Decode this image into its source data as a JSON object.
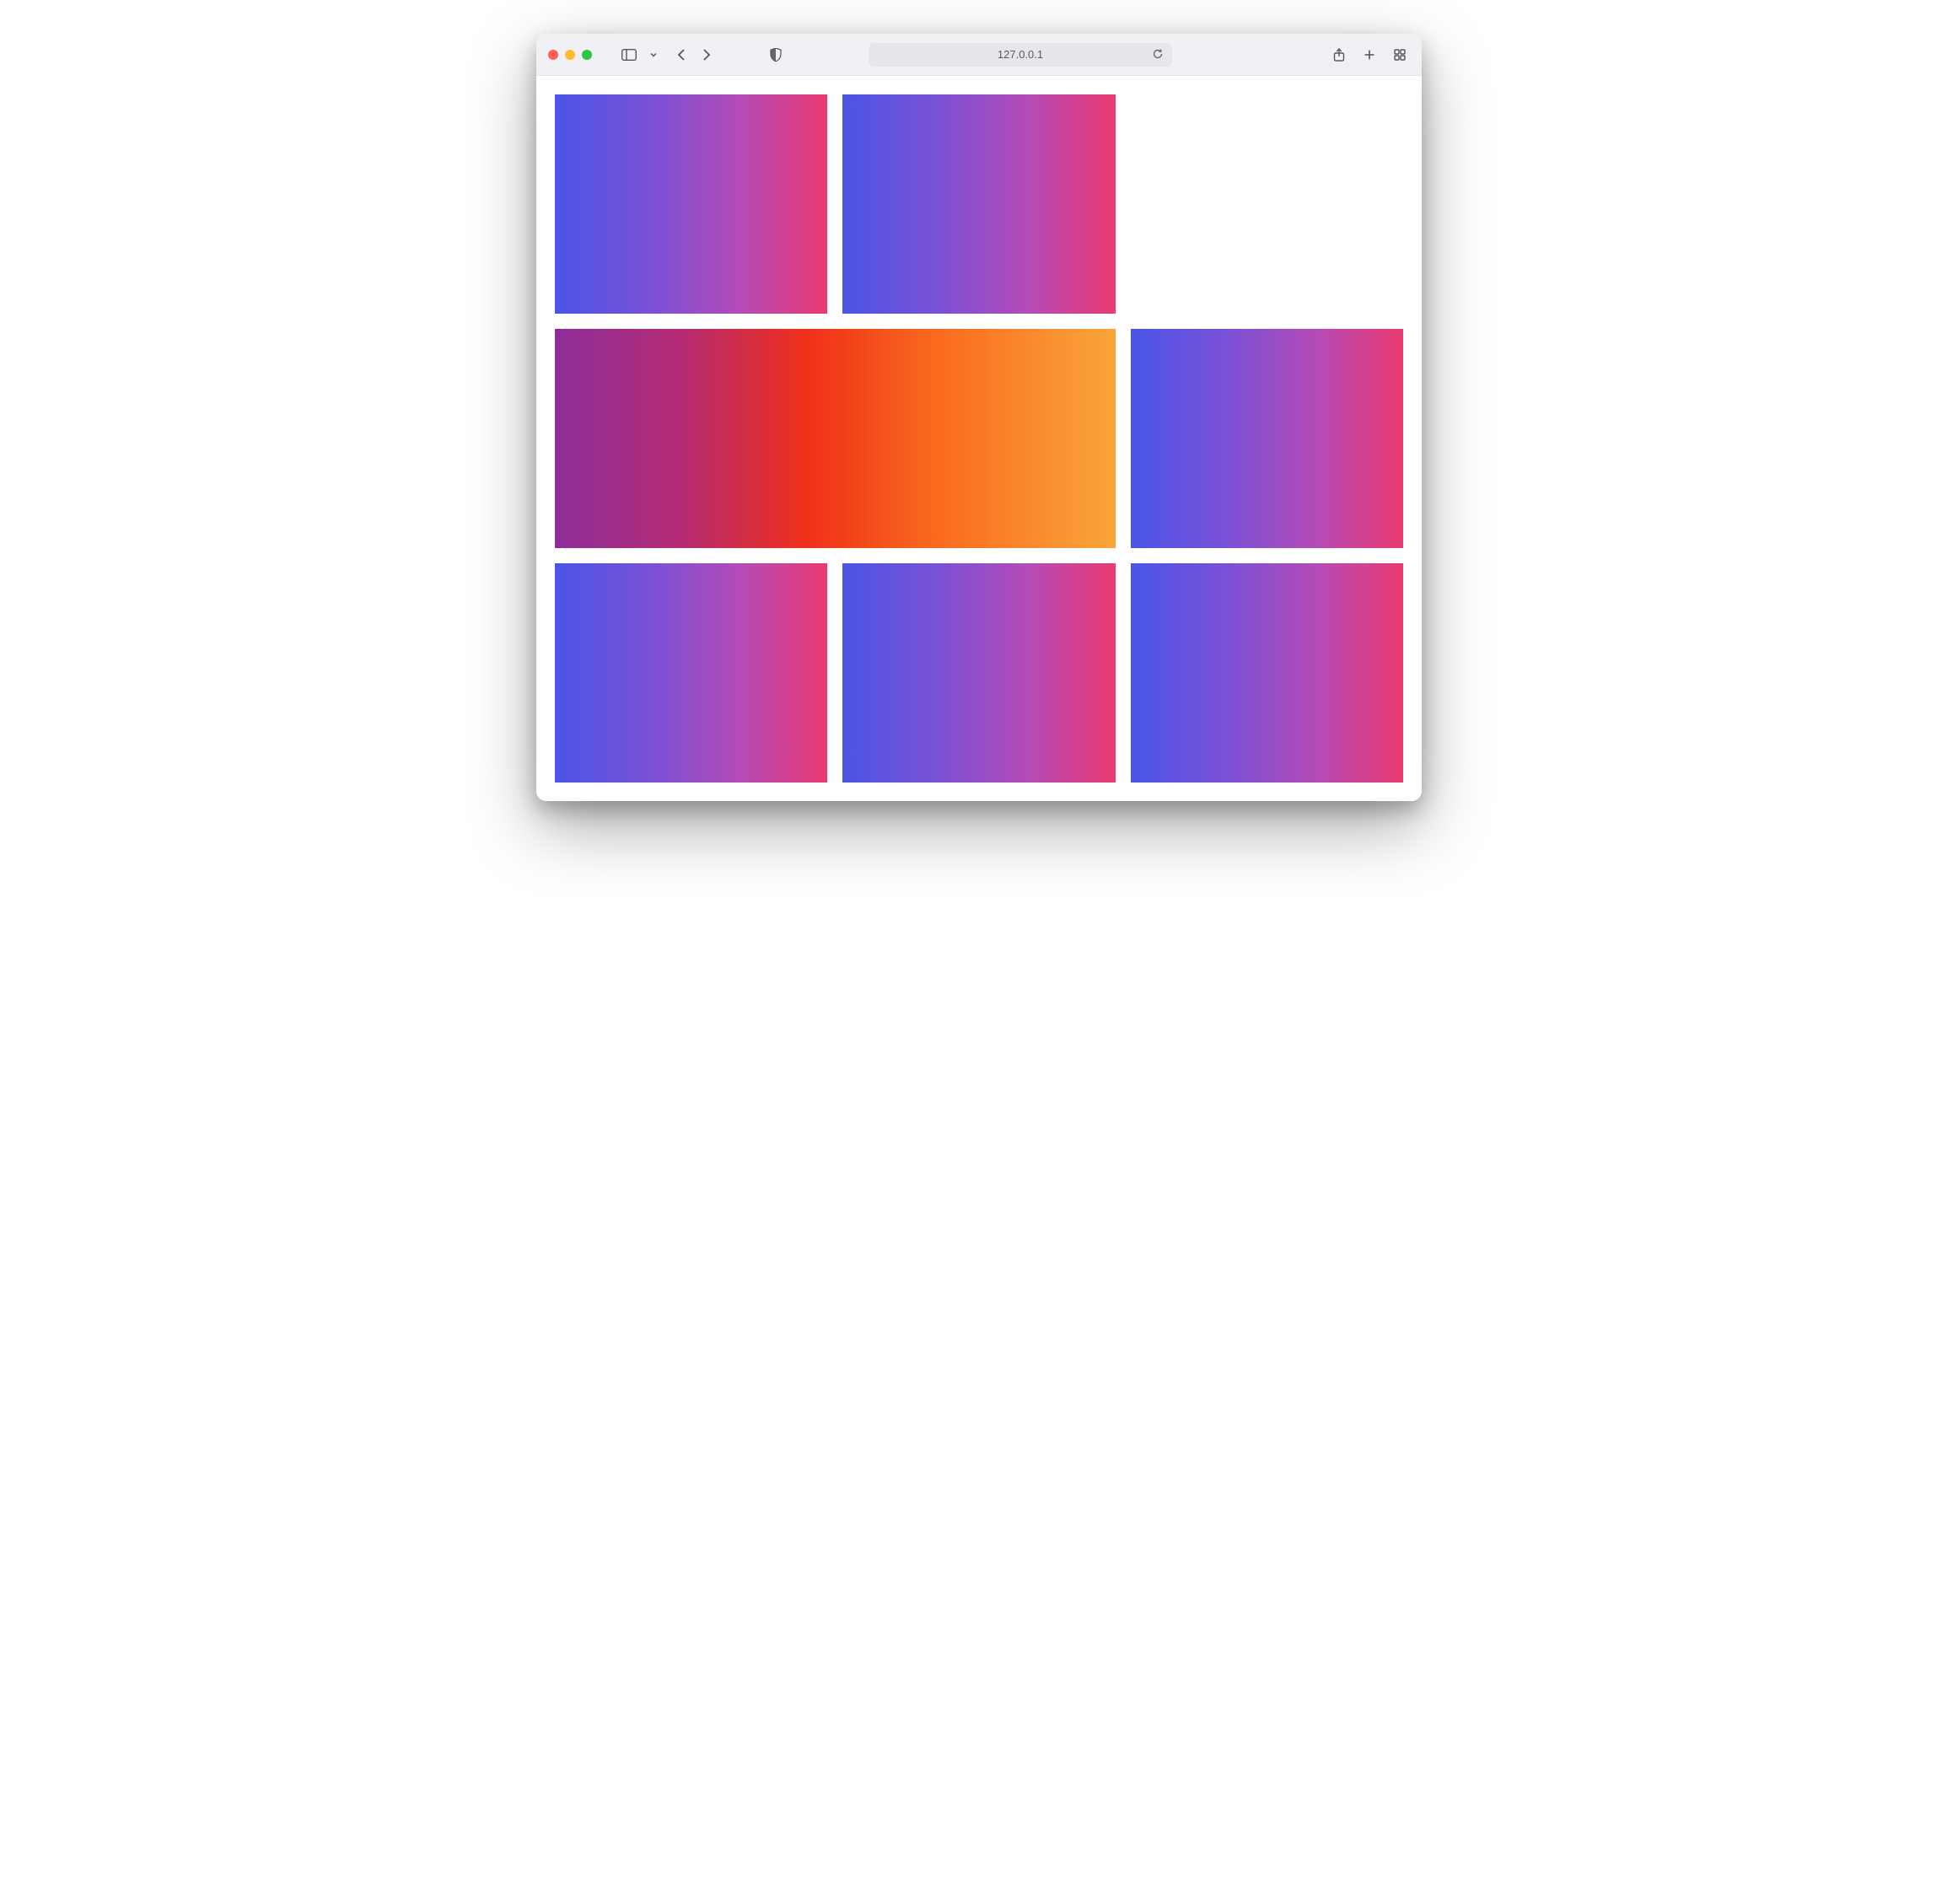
{
  "browser": {
    "address": "127.0.0.1"
  },
  "page": {
    "tiles": [
      {
        "row": 1,
        "col": 1,
        "span": 1,
        "variant": "g1"
      },
      {
        "row": 1,
        "col": 2,
        "span": 1,
        "variant": "g1"
      },
      {
        "row": 1,
        "col": 3,
        "span": 1,
        "variant": "empty"
      },
      {
        "row": 2,
        "col": 1,
        "span": 2,
        "variant": "g2"
      },
      {
        "row": 2,
        "col": 3,
        "span": 1,
        "variant": "g1"
      },
      {
        "row": 3,
        "col": 1,
        "span": 1,
        "variant": "g1"
      },
      {
        "row": 3,
        "col": 2,
        "span": 1,
        "variant": "g1"
      },
      {
        "row": 3,
        "col": 3,
        "span": 1,
        "variant": "g1"
      }
    ],
    "gradients": {
      "g1": [
        "#4a55e6",
        "#7a51d6",
        "#b44bb7",
        "#ea3a72"
      ],
      "g2": [
        "#8e2e9a",
        "#b32b75",
        "#ef3019",
        "#f96a1e",
        "#f9a53a"
      ]
    }
  }
}
